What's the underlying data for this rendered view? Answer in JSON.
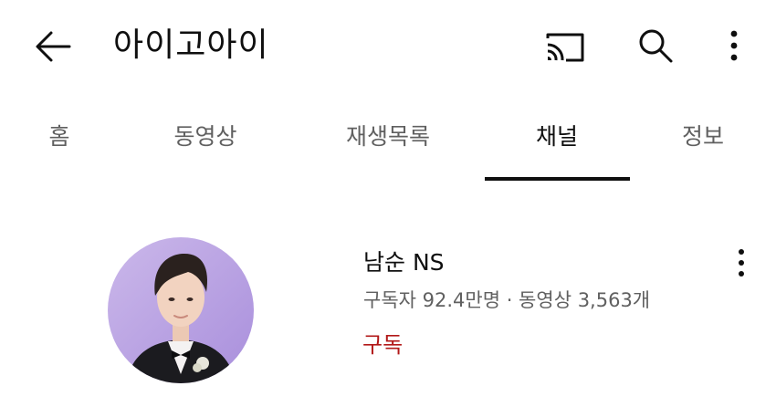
{
  "appbar": {
    "title": "아이고아이",
    "back_icon": "arrow-left-icon",
    "cast_icon": "cast-icon",
    "search_icon": "search-icon",
    "more_icon": "more-vertical-icon"
  },
  "tabs": [
    {
      "label": "홈",
      "active": false
    },
    {
      "label": "동영상",
      "active": false
    },
    {
      "label": "재생목록",
      "active": false
    },
    {
      "label": "채널",
      "active": true
    },
    {
      "label": "정보",
      "active": false
    }
  ],
  "channel_card": {
    "name": "남순 NS",
    "meta": "구독자 92.4만명 · 동영상 3,563개",
    "subscribe_label": "구독",
    "subscribe_color": "#b21818",
    "more_icon": "more-vertical-icon"
  }
}
